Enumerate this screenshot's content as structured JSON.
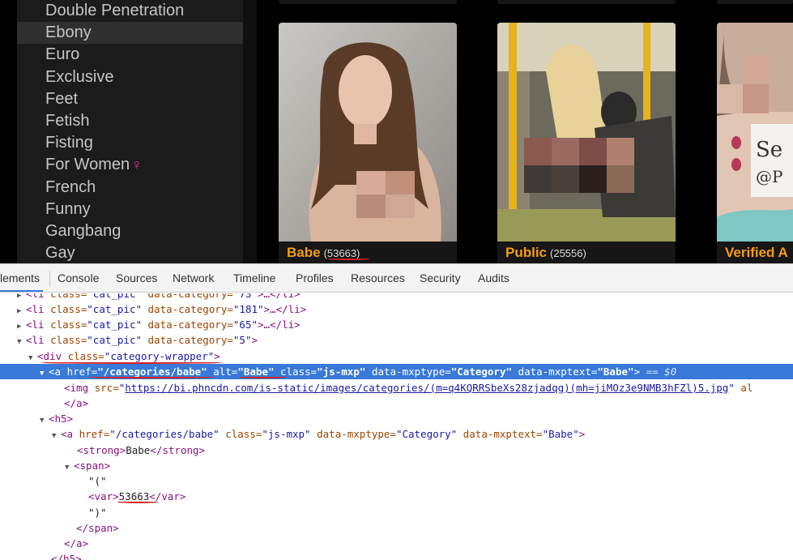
{
  "sidebar": {
    "categories": [
      {
        "label": "Double Penetration"
      },
      {
        "label": "Ebony",
        "active": true
      },
      {
        "label": "Euro"
      },
      {
        "label": "Exclusive"
      },
      {
        "label": "Feet"
      },
      {
        "label": "Fetish"
      },
      {
        "label": "Fisting"
      },
      {
        "label": "For Women",
        "symbol": "♀"
      },
      {
        "label": "French"
      },
      {
        "label": "Funny"
      },
      {
        "label": "Gangbang"
      },
      {
        "label": "Gay"
      }
    ]
  },
  "cards": [
    {
      "title": "Babe",
      "count": "(53663)"
    },
    {
      "title": "Public",
      "count": "(25556)"
    },
    {
      "title": "Verified A"
    }
  ],
  "devtools": {
    "tabs": [
      "lements",
      "Console",
      "Sources",
      "Network",
      "Timeline",
      "Profiles",
      "Resources",
      "Security",
      "Audits"
    ],
    "selected_tab": "lements",
    "rows": {
      "r0": {
        "tag": "<li",
        "a1": " class=",
        "v1": "\"cat_pic\"",
        "a2": " data-category=",
        "v2": "\"73\"",
        "end": ">…</li>"
      },
      "r1": {
        "tag": "<li",
        "a1": " class=",
        "v1": "\"cat_pic\"",
        "a2": " data-category=",
        "v2": "\"181\"",
        "end": ">…</li>"
      },
      "r2": {
        "tag": "<li",
        "a1": " class=",
        "v1": "\"cat_pic\"",
        "a2": " data-category=",
        "v2": "\"65\"",
        "end": ">…</li>"
      },
      "r3": {
        "tag": "<li",
        "a1": " class=",
        "v1": "\"cat_pic\"",
        "a2": " data-category=",
        "v2": "\"5\"",
        "end": ">"
      },
      "r4": {
        "tag": "<div",
        "a1": " class=",
        "v1": "\"category-wrapper\"",
        "end": ">"
      },
      "r5": {
        "tag": "<a",
        "a1": " href=",
        "v1": "\"/categories/babe\"",
        "a2": " alt=",
        "v2": "\"Babe\"",
        "a3": " class=",
        "v3": "\"js-mxp\"",
        "a4": " data-mxptype=",
        "v4": "\"Category\"",
        "a5": " data-mxptext=",
        "v5": "\"Babe\"",
        "end": ">",
        "marker": " == $0"
      },
      "r6": {
        "tag": "<img",
        "a1": " src=",
        "v1": "\"",
        "link": "https://bi.phncdn.com/is-static/images/categories/(m=q4KQRRSbeXs28zjadqg)(mh=jiMOz3e9NMB3hFZl)5.jpg",
        "v1b": "\"",
        "a2": " al"
      },
      "r7": {
        "tag": "</a>"
      },
      "r8": {
        "tag": "<h5>"
      },
      "r9": {
        "tag": "<a",
        "a1": " href=",
        "v1": "\"/categories/babe\"",
        "a2": " class=",
        "v2": "\"js-mxp\"",
        "a3": " data-mxptype=",
        "v3": "\"Category\"",
        "a4": " data-mxptext=",
        "v4": "\"Babe\"",
        "end": ">"
      },
      "r10": {
        "tag": "<strong>",
        "text": "Babe",
        "close": "</strong>"
      },
      "r11": {
        "tag": "<span>"
      },
      "r12": {
        "text": "\"(\""
      },
      "r13": {
        "tag": "<var>",
        "text": "53663",
        "close": "</var>"
      },
      "r14": {
        "text": "\")\""
      },
      "r15": {
        "tag": "</span>"
      },
      "r16": {
        "tag": "</a>"
      },
      "r17": {
        "tag": "</h5>"
      }
    }
  },
  "colors": {
    "accent_orange": "#f29d14",
    "selection_blue": "#3879d9",
    "annotation_red": "#d42222",
    "female_symbol": "#e03a8e"
  }
}
